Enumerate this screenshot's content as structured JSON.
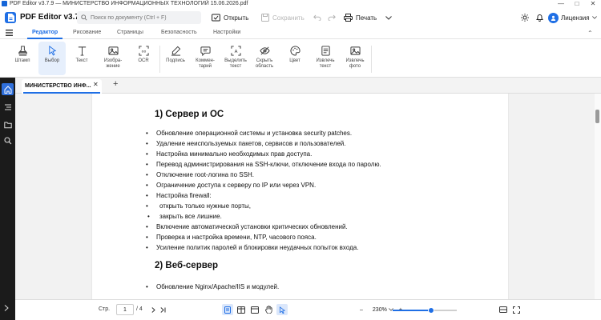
{
  "window": {
    "title": "PDF Editor v3.7.9 — МИНИСТЕРСТВО ИНФОРМАЦИОННЫХ ТЕХНОЛОГИЙ 15.06.2026.pdf",
    "controls": [
      "—",
      "□",
      "✕"
    ]
  },
  "header": {
    "app_name": "PDF Editor v3.7.9",
    "search_placeholder": "Поиск по документу (Ctrl + F)",
    "open": "Открыть",
    "save": "Сохранить",
    "print": "Печать",
    "license": "Лицензия"
  },
  "menu_tabs": [
    {
      "label": "Редактор",
      "active": true
    },
    {
      "label": "Рисование",
      "active": false
    },
    {
      "label": "Страницы",
      "active": false
    },
    {
      "label": "Безопасность",
      "active": false
    },
    {
      "label": "Настройки",
      "active": false
    }
  ],
  "tools": [
    {
      "label": "Штамп",
      "icon": "stamp-icon",
      "selected": false
    },
    {
      "label": "Выбор",
      "icon": "cursor-icon",
      "selected": true
    },
    {
      "label": "Текст",
      "icon": "text-icon",
      "selected": false
    },
    {
      "label": "Изобра-\nжение",
      "icon": "image-icon",
      "selected": false
    },
    {
      "label": "OCR",
      "icon": "ocr-icon",
      "selected": false
    },
    {
      "label": "Подпись",
      "icon": "signature-icon",
      "selected": false
    },
    {
      "label": "Коммен-\nтарий",
      "icon": "comment-icon",
      "selected": false
    },
    {
      "label": "Выделить\nтекст",
      "icon": "highlight-text-icon",
      "selected": false
    },
    {
      "label": "Скрыть\nобласть",
      "icon": "hide-area-icon",
      "selected": false
    },
    {
      "label": "Цвет",
      "icon": "palette-icon",
      "selected": false
    },
    {
      "label": "Извлечь\nтекст",
      "icon": "extract-text-icon",
      "selected": false
    },
    {
      "label": "Извлечь\nфото",
      "icon": "extract-photo-icon",
      "selected": false
    }
  ],
  "document_tab": {
    "name": "МИНИСТЕРСТВО ИНФ...",
    "close": "✕",
    "new": "+"
  },
  "page": {
    "section1_title": "1) Сервер и ОС",
    "section1_items": [
      {
        "bullet": "•",
        "text": "Обновление операционной системы и установка security patches."
      },
      {
        "bullet": "•",
        "text": "Удаление неиспользуемых пакетов, сервисов и пользователей."
      },
      {
        "bullet": "•",
        "text": "Настройка минимально необходимых прав доступа."
      },
      {
        "bullet": "•",
        "text": "Перевод администрирования на SSH-ключи, отключение входа по паролю."
      },
      {
        "bullet": "•",
        "text": "Отключение root-логина по SSH."
      },
      {
        "bullet": "•",
        "text": "Ограничение доступа к серверу по IP или через VPN."
      },
      {
        "bullet": "•",
        "text": "Настройка firewall:"
      },
      {
        "bullet": "•",
        "text": "открыть только нужные порты,"
      },
      {
        "bullet": "•",
        "text": "закрыть все лишние."
      },
      {
        "bullet": "•",
        "text": "Включение автоматической установки критических обновлений."
      },
      {
        "bullet": "•",
        "text": "Проверка и настройка времени, NTP, часового пояса."
      },
      {
        "bullet": "•",
        "text": "Усиление политик паролей и блокировки неудачных попыток входа."
      }
    ],
    "section2_title": "2) Веб-сервер",
    "section2_items": [
      {
        "bullet": "•",
        "text": "Обновление Nginx/Apache/IIS и модулей."
      }
    ]
  },
  "statusbar": {
    "page_label": "Стр.",
    "current_page": "1",
    "total_pages": "/ 4",
    "zoom": "230%",
    "zoom_minus": "–",
    "zoom_plus": "+",
    "zoom_level": 0.6
  },
  "colors": {
    "accent": "#1f6fe5",
    "rail": "#1b1b1b"
  }
}
